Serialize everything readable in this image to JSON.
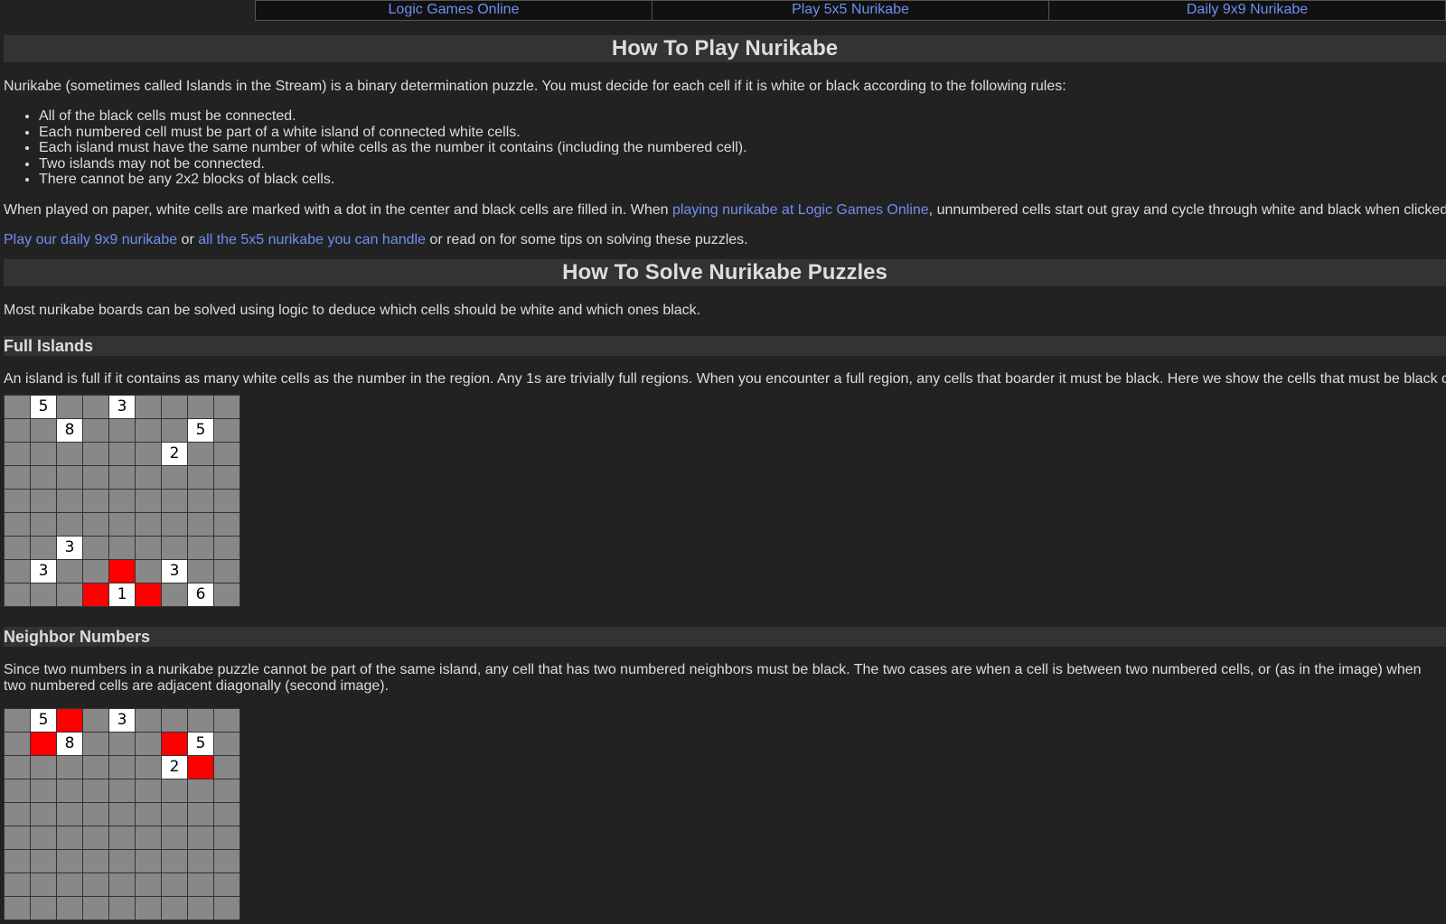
{
  "nav": {
    "links": [
      "Logic Games Online",
      "Play 5x5 Nurikabe",
      "Daily 9x9 Nurikabe"
    ]
  },
  "how_to_play": {
    "title": "How To Play Nurikabe",
    "intro": "Nurikabe (sometimes called Islands in the Stream) is a binary determination puzzle. You must decide for each cell if it is white or black according to the following rules:",
    "rules": [
      "All of the black cells must be connected.",
      "Each numbered cell must be part of a white island of connected white cells.",
      "Each island must have the same number of white cells as the number it contains (including the numbered cell).",
      "Two islands may not be connected.",
      "There cannot be any 2x2 blocks of black cells."
    ],
    "paper_text_1": "When played on paper, white cells are marked with a dot in the center and black cells are filled in. When ",
    "paper_link": "playing nurikabe at Logic Games Online",
    "paper_text_2": ", unnumbered cells start out gray and cycle through white and black when clicked.",
    "play_link_1": "Play our daily 9x9 nurikabe",
    "play_or": " or ",
    "play_link_2": "all the 5x5 nurikabe you can handle",
    "play_text": " or read on for some tips on solving these puzzles."
  },
  "how_to_solve": {
    "title": "How To Solve Nurikabe Puzzles",
    "intro": "Most nurikabe boards can be solved using logic to deduce which cells should be white and which ones black."
  },
  "full_islands": {
    "title": "Full Islands",
    "text": "An island is full if it contains as many white cells as the number in the region. Any 1s are trivially full regions. When you encounter a full region, any cells that boarder it must be black. Here we show the cells that must be black c",
    "board": [
      [
        "",
        "5",
        "",
        "",
        "3",
        "",
        "",
        "",
        ""
      ],
      [
        "",
        "",
        "8",
        "",
        "",
        "",
        "",
        "5",
        ""
      ],
      [
        "",
        "",
        "",
        "",
        "",
        "",
        "2",
        "",
        ""
      ],
      [
        "",
        "",
        "",
        "",
        "",
        "",
        "",
        "",
        ""
      ],
      [
        "",
        "",
        "",
        "",
        "",
        "",
        "",
        "",
        ""
      ],
      [
        "",
        "",
        "",
        "",
        "",
        "",
        "",
        "",
        ""
      ],
      [
        "",
        "",
        "3",
        "",
        "",
        "",
        "",
        "",
        ""
      ],
      [
        "",
        "3",
        "",
        "",
        "R",
        "",
        "3",
        "",
        ""
      ],
      [
        "",
        "",
        "",
        "R",
        "1",
        "R",
        "",
        "6",
        ""
      ]
    ]
  },
  "neighbor_numbers": {
    "title": "Neighbor Numbers",
    "text": "Since two numbers in a nurikabe puzzle cannot be part of the same island, any cell that has two numbered neighbors must be black. The two cases are when a cell is between two numbered cells, or (as in the image) when two numbered cells are adjacent diagonally (second image).",
    "board": [
      [
        "",
        "5",
        "R",
        "",
        "3",
        "",
        "",
        "",
        ""
      ],
      [
        "",
        "R",
        "8",
        "",
        "",
        "",
        "R",
        "5",
        ""
      ],
      [
        "",
        "",
        "",
        "",
        "",
        "",
        "2",
        "R",
        ""
      ],
      [
        "",
        "",
        "",
        "",
        "",
        "",
        "",
        "",
        ""
      ],
      [
        "",
        "",
        "",
        "",
        "",
        "",
        "",
        "",
        ""
      ],
      [
        "",
        "",
        "",
        "",
        "",
        "",
        "",
        "",
        ""
      ],
      [
        "",
        "",
        "",
        "",
        "",
        "",
        "",
        "",
        ""
      ],
      [
        "",
        "",
        "",
        "",
        "",
        "",
        "",
        "",
        ""
      ],
      [
        "",
        "",
        "",
        "",
        "",
        "",
        "",
        "",
        ""
      ]
    ]
  }
}
